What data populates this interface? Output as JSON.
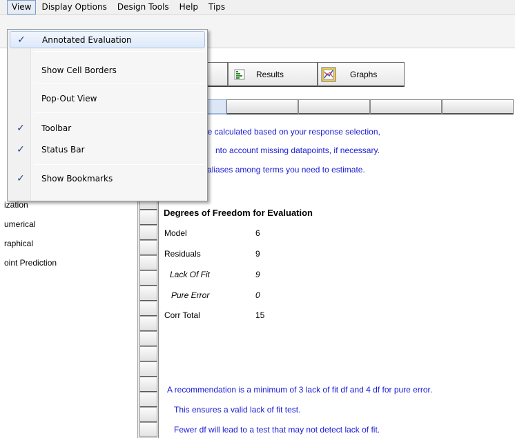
{
  "menubar": {
    "items": [
      "View",
      "Display Options",
      "Design Tools",
      "Help",
      "Tips"
    ]
  },
  "view_menu": {
    "items": [
      {
        "label": "Annotated Evaluation",
        "checked": true
      },
      {
        "label": "Show Cell Borders",
        "checked": false
      },
      {
        "label": "Pop-Out View",
        "checked": false
      },
      {
        "label": "Toolbar",
        "checked": true
      },
      {
        "label": "Status Bar",
        "checked": true
      },
      {
        "label": "Show Bookmarks",
        "checked": true
      }
    ],
    "check_glyph": "✓"
  },
  "tree": {
    "items": [
      "ization",
      "umerical",
      "raphical",
      "oint Prediction"
    ]
  },
  "tabs": {
    "partial_label": "",
    "results_label": "Results",
    "graphs_label": "Graphs"
  },
  "evaluation": {
    "intro_lines": [
      "are calculated based on your response selection,",
      "nto account missing datapoints, if necessary.",
      "watch for aliases among terms you need to estimate."
    ],
    "df_heading": "Degrees of Freedom for Evaluation",
    "df_rows": [
      {
        "label": "Model",
        "value": "6"
      },
      {
        "label": "Residuals",
        "value": "9"
      },
      {
        "label": "Lack Of Fit",
        "value": "9"
      },
      {
        "label": "Pure Error",
        "value": "0"
      },
      {
        "label": "Corr Total",
        "value": "15"
      }
    ],
    "recommendation_lines": [
      "A recommendation is a minimum of 3 lack of fit df and 4 df for pure error.",
      "This ensures a valid lack of fit test.",
      "Fewer df will lead to a test that may not detect lack of fit."
    ]
  },
  "colors": {
    "text_blue": "#1a1ad6",
    "check_blue": "#1b3f86",
    "menu_highlight": "#dde9f9"
  },
  "icons": {
    "results": "results-sheet-icon",
    "graphs": "graphs-chart-icon"
  }
}
